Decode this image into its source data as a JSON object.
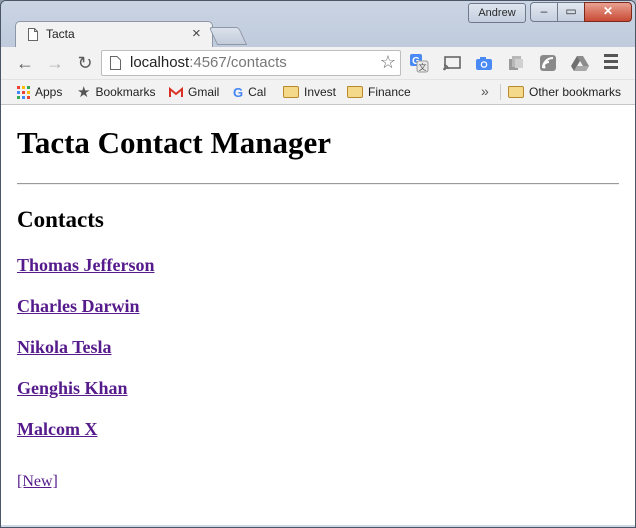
{
  "window": {
    "profile_name": "Andrew",
    "controls": {
      "minimize": "‒",
      "maximize": "▭",
      "close": "✕"
    }
  },
  "tab": {
    "title": "Tacta",
    "close": "×"
  },
  "toolbar": {
    "back": "←",
    "forward": "→",
    "reload": "↻",
    "url_host": "localhost",
    "url_path": ":4567/contacts",
    "star": "☆"
  },
  "bookmarks": {
    "items": [
      {
        "label": "Apps",
        "icon": "apps-grid-icon"
      },
      {
        "label": "Bookmarks",
        "icon": "star-icon"
      },
      {
        "label": "Gmail",
        "icon": "gmail-icon"
      },
      {
        "label": "Cal",
        "icon": "google-icon"
      },
      {
        "label": "Invest",
        "icon": "folder-icon"
      },
      {
        "label": "Finance",
        "icon": "folder-icon"
      }
    ],
    "overflow": "»",
    "other": "Other bookmarks"
  },
  "page": {
    "title": "Tacta Contact Manager",
    "section_heading": "Contacts",
    "contacts": [
      "Thomas Jefferson",
      "Charles Darwin",
      "Nikola Tesla",
      "Genghis Khan",
      "Malcom X"
    ],
    "new_link": "[New]"
  },
  "colors": {
    "link_visited": "#551a8b",
    "close_button": "#c74a34",
    "chrome_frame": "#cfd8e6"
  }
}
